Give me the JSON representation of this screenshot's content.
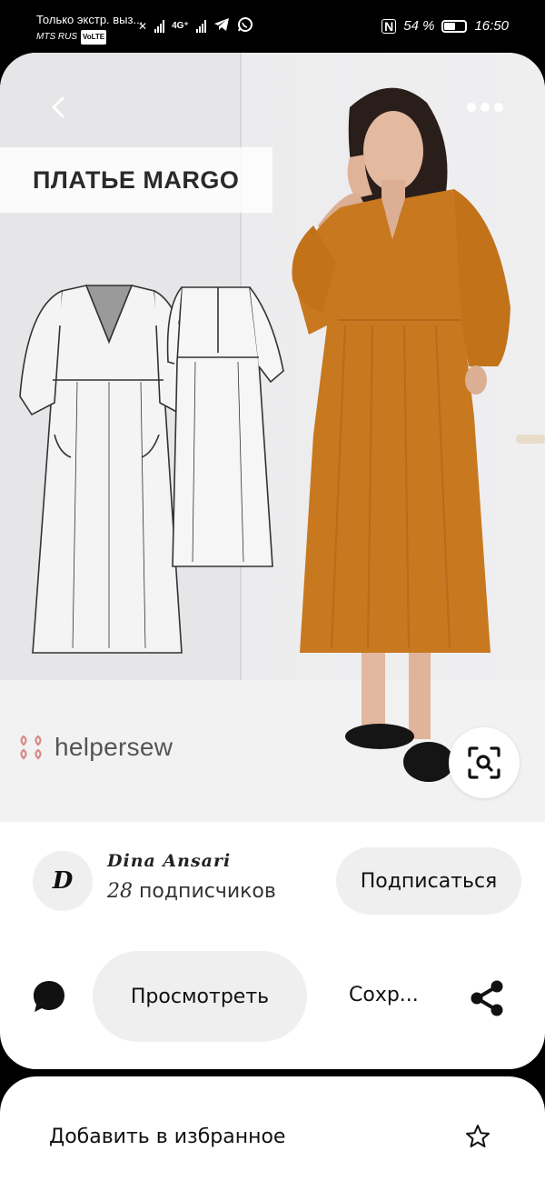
{
  "status_bar": {
    "notification": "Только экстр. выз...",
    "carrier": "MTS RUS",
    "volte": "VoLTE",
    "network": "4G⁺",
    "battery": "54 %",
    "time": "16:50"
  },
  "pin": {
    "banner_title": "ПЛАТЬЕ MARGO",
    "brand": "helpersew",
    "colors": {
      "dress": "#c8781e",
      "background": "#ececee"
    }
  },
  "creator": {
    "avatar_letter": "D",
    "name": "Dina Ansari",
    "followers_count": "28",
    "followers_label": "подписчиков",
    "subscribe_label": "Подписаться"
  },
  "actions": {
    "view_label": "Просмотреть",
    "save_label": "Сохр..."
  },
  "sheet": {
    "favorite_label": "Добавить в избранное"
  },
  "icons": [
    "back-icon",
    "more-icon",
    "visual-search-icon",
    "comment-icon",
    "share-icon",
    "star-icon",
    "telegram-icon",
    "whatsapp-icon",
    "battery-icon"
  ]
}
